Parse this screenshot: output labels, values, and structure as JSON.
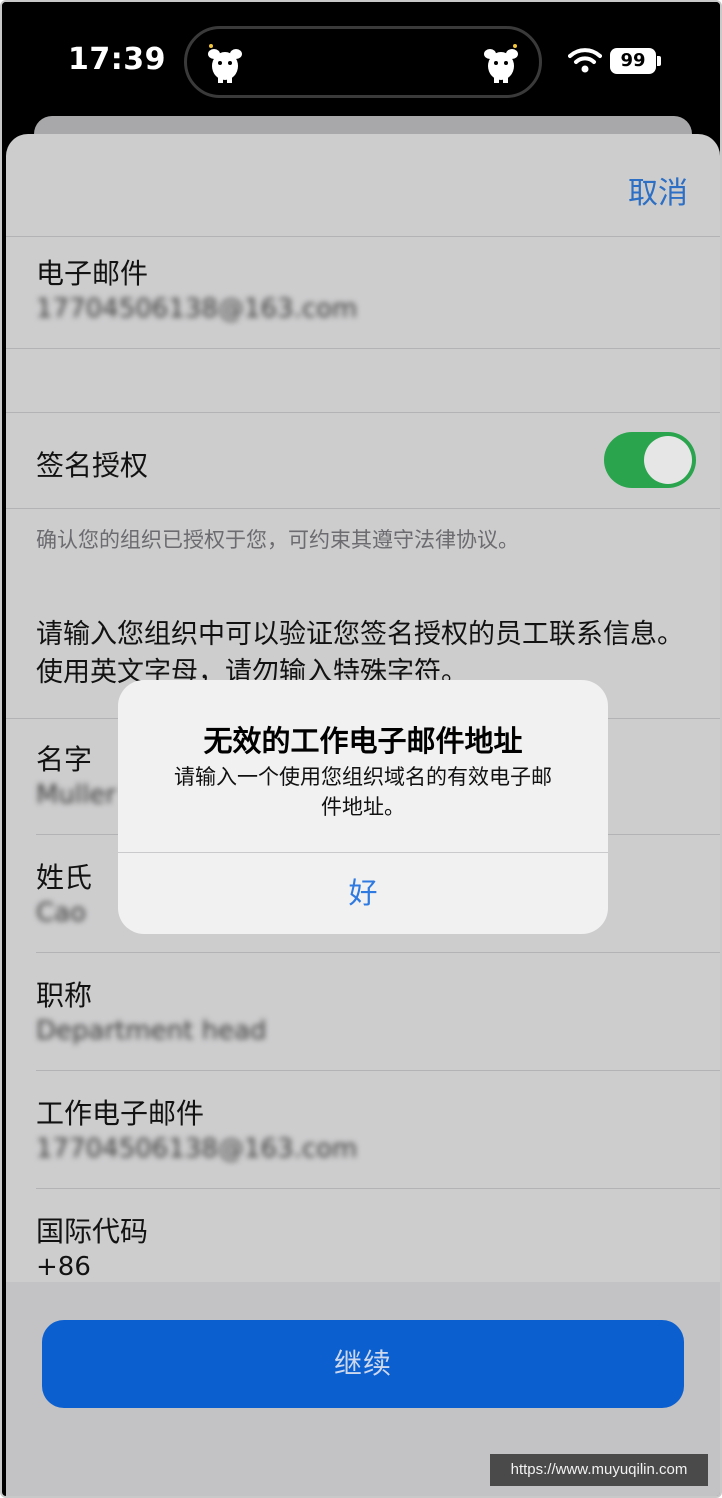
{
  "status_bar": {
    "time": "17:39",
    "battery": "99",
    "wifi_icon": "wifi-icon",
    "mascot_icon": "mascot-icon"
  },
  "header": {
    "cancel_label": "取消"
  },
  "form": {
    "email": {
      "label": "电子邮件",
      "value": "17704506138@163.com"
    },
    "signing_authority": {
      "label": "签名授权",
      "enabled": true
    },
    "helper_text": "确认您的组织已授权于您，可约束其遵守法律协议。",
    "instruction": "请输入您组织中可以验证您签名授权的员工联系信息。使用英文字母，请勿输入特殊字符。",
    "first_name": {
      "label": "名字",
      "value": "Muller"
    },
    "last_name": {
      "label": "姓氏",
      "value": "Cao"
    },
    "job_title": {
      "label": "职称",
      "value": "Department head"
    },
    "work_email": {
      "label": "工作电子邮件",
      "value": "17704506138@163.com"
    },
    "country_code": {
      "label": "国际代码",
      "value": "+86"
    }
  },
  "footer": {
    "continue_label": "继续"
  },
  "alert": {
    "title": "无效的工作电子邮件地址",
    "message": "请输入一个使用您组织域名的有效电子邮件地址。",
    "ok_label": "好"
  },
  "watermark": "https://www.muyuqilin.com",
  "colors": {
    "accent": "#2f7ae0",
    "toggle_on": "#2aa44d",
    "button": "#0b5fcf"
  }
}
